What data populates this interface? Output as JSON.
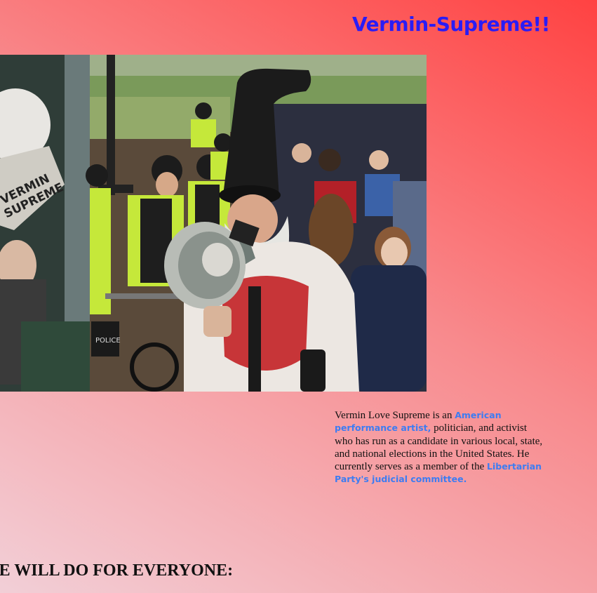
{
  "header": {
    "title": "Vermin-Supreme!!"
  },
  "bio": {
    "text_1": "Vermin Love Supreme is an ",
    "link_1": "American performance artist,",
    "text_2": " politician, and activist who has run as a candidate in various local, state, and national elections in the United States. He currently serves as a member of the ",
    "link_2": "Libertarian Party's judicial committee."
  },
  "photo": {
    "megaphone_text_line1": "VERMIN",
    "megaphone_text_line2": "SUPREME",
    "police_label": "POLICE"
  },
  "section": {
    "heading": "ME WILL DO FOR EVERYONE:"
  },
  "colors": {
    "title": "#2a1cf5",
    "link": "#3d7cf2"
  }
}
